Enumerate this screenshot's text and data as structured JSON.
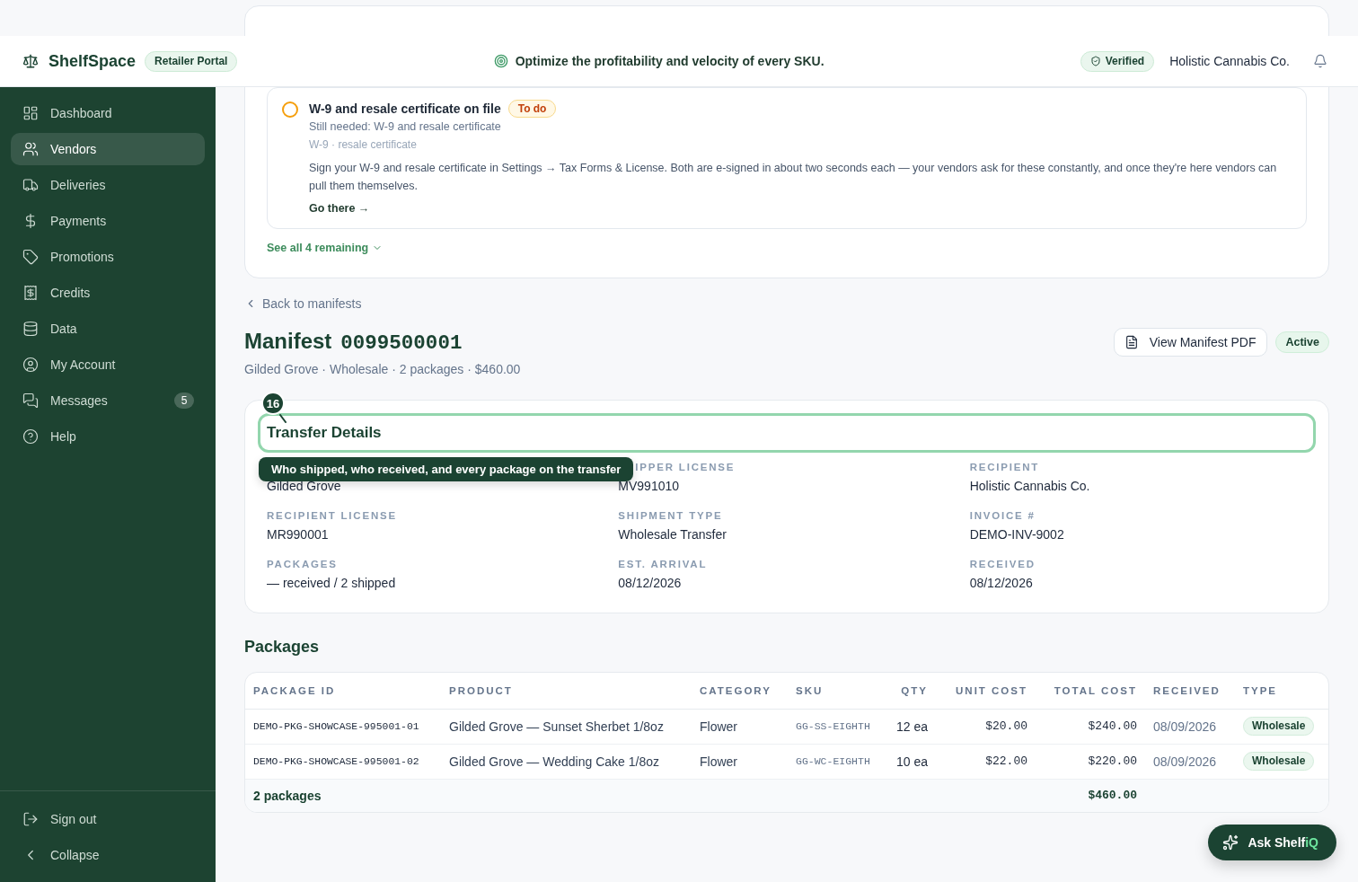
{
  "header": {
    "brand": "ShelfSpace",
    "portal_badge": "Retailer Portal",
    "tagline": "Optimize the profitability and velocity of every SKU.",
    "verified_badge": "Verified",
    "account_name": "Holistic Cannabis Co."
  },
  "sidebar": {
    "items": [
      {
        "label": "Dashboard",
        "selected": false
      },
      {
        "label": "Vendors",
        "selected": true
      },
      {
        "label": "Deliveries",
        "selected": false
      },
      {
        "label": "Payments",
        "selected": false
      },
      {
        "label": "Promotions",
        "selected": false
      },
      {
        "label": "Credits",
        "selected": false
      },
      {
        "label": "Data",
        "selected": false
      },
      {
        "label": "My Account",
        "selected": false
      },
      {
        "label": "Messages",
        "selected": false,
        "badge": "5"
      },
      {
        "label": "Help",
        "selected": false
      }
    ],
    "footer_items": [
      {
        "label": "Sign out"
      },
      {
        "label": "Collapse"
      }
    ]
  },
  "checklist": {
    "items": [
      {
        "title": "W-9 and resale certificate on file",
        "completed": false,
        "status_label": "To do",
        "needed": "Still needed: W-9 and resale certificate",
        "documents": "W-9 · resale certificate",
        "description": "Sign your W-9 and resale certificate in Settings → Tax Forms & License. Both are e-signed in about two seconds each — your vendors ask for these constantly, and once they're here vendors can pull them themselves.",
        "action": "Go there →"
      }
    ],
    "see_all": "See all 4 remaining"
  },
  "back_link": "Back to manifests",
  "manifest": {
    "title": "Manifest",
    "number": "0099500001",
    "summary": "Gilded Grove · Wholesale · 2 packages · $460.00",
    "pdf_button": "View Manifest PDF",
    "status": "Active"
  },
  "transfer_details": {
    "title": "Transfer Details",
    "step_number": "16",
    "tooltip": "Who shipped, who received, and every package on the transfer",
    "value_under_tooltip": "Gilded Grove",
    "fields": [
      {
        "label": "IPPER LICENSE",
        "value": "MV991010"
      },
      {
        "label": "RECIPIENT",
        "value": "Holistic Cannabis Co."
      },
      {
        "label": "RECIPIENT LICENSE",
        "value": "MR990001"
      },
      {
        "label": "SHIPMENT TYPE",
        "value": "Wholesale Transfer"
      },
      {
        "label": "INVOICE #",
        "value": "DEMO-INV-9002"
      },
      {
        "label": "PACKAGES",
        "value": "— received / 2 shipped"
      },
      {
        "label": "EST. ARRIVAL",
        "value": "08/12/2026"
      },
      {
        "label": "RECEIVED",
        "value": "08/12/2026"
      }
    ]
  },
  "packages": {
    "title": "Packages",
    "columns": [
      {
        "label": "PACKAGE ID",
        "kind": "id"
      },
      {
        "label": "PRODUCT",
        "kind": "text"
      },
      {
        "label": "CATEGORY",
        "kind": "text"
      },
      {
        "label": "SKU",
        "kind": "sku"
      },
      {
        "label": "QTY",
        "kind": "quantity"
      },
      {
        "label": "UNIT COST",
        "kind": "money"
      },
      {
        "label": "TOTAL COST",
        "kind": "money"
      },
      {
        "label": "RECEIVED",
        "kind": "date"
      },
      {
        "label": "TYPE",
        "kind": "tag"
      }
    ],
    "rows": [
      {
        "cells": [
          "DEMO-PKG-SHOWCASE-995001-01",
          "Gilded Grove — Sunset Sherbet 1/8oz",
          "Flower",
          "GG-SS-EIGHTH",
          "12 ea",
          "$20.00",
          "$240.00",
          "08/09/2026",
          "Wholesale"
        ]
      },
      {
        "cells": [
          "DEMO-PKG-SHOWCASE-995001-02",
          "Gilded Grove — Wedding Cake 1/8oz",
          "Flower",
          "GG-WC-EIGHTH",
          "10 ea",
          "$22.00",
          "$220.00",
          "08/09/2026",
          "Wholesale"
        ]
      }
    ],
    "footer": {
      "count": "2 packages",
      "total": "$460.00"
    }
  },
  "assistant_button": {
    "label": "Ask Shelf",
    "accent": "iQ"
  }
}
